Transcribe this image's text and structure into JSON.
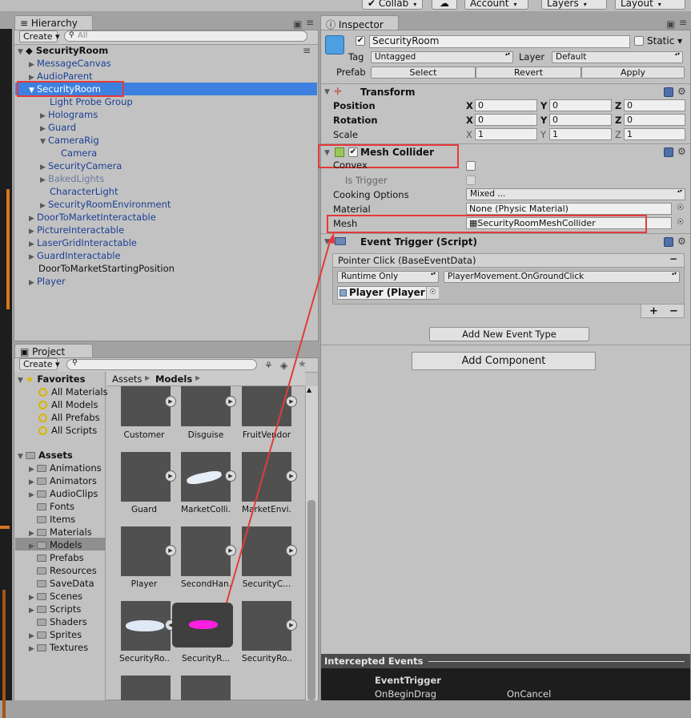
{
  "toolbar": {
    "collab": "Collab",
    "account": "Account",
    "layers": "Layers",
    "layout": "Layout"
  },
  "hierarchy": {
    "tab": "Hierarchy",
    "create": "Create",
    "search_placeholder": "All",
    "scene": "SecurityRoom",
    "items": [
      {
        "label": "MessageCanvas"
      },
      {
        "label": "AudioParent"
      },
      {
        "label": "SecurityRoom"
      },
      {
        "label": "Light Probe Group"
      },
      {
        "label": "Holograms"
      },
      {
        "label": "Guard"
      },
      {
        "label": "CameraRig"
      },
      {
        "label": "Camera"
      },
      {
        "label": "SecurityCamera"
      },
      {
        "label": "BakedLights"
      },
      {
        "label": "CharacterLight"
      },
      {
        "label": "SecurityRoomEnvironment"
      },
      {
        "label": "DoorToMarketInteractable"
      },
      {
        "label": "PictureInteractable"
      },
      {
        "label": "LaserGridInteractable"
      },
      {
        "label": "GuardInteractable"
      },
      {
        "label": "DoorToMarketStartingPosition"
      },
      {
        "label": "Player"
      }
    ]
  },
  "project": {
    "tab": "Project",
    "create": "Create",
    "favorites_label": "Favorites",
    "favorites": [
      "All Materials",
      "All Models",
      "All Prefabs",
      "All Scripts"
    ],
    "assets_label": "Assets",
    "folders": [
      "Animations",
      "Animators",
      "AudioClips",
      "Fonts",
      "Items",
      "Materials",
      "Models",
      "Prefabs",
      "Resources",
      "SaveData",
      "Scenes",
      "Scripts",
      "Shaders",
      "Sprites",
      "Textures"
    ],
    "breadcrumb": {
      "root": "Assets",
      "current": "Models"
    },
    "assets": [
      "Customer",
      "Disguise",
      "FruitVendor",
      "Guard",
      "MarketColli...",
      "MarketEnvi...",
      "Player",
      "SecondHan...",
      "SecurityC...",
      "SecurityRo...",
      "SecurityR...",
      "SecurityRo..."
    ]
  },
  "inspector": {
    "tab": "Inspector",
    "object_name": "SecurityRoom",
    "static_label": "Static",
    "tag_label": "Tag",
    "tag_value": "Untagged",
    "layer_label": "Layer",
    "layer_value": "Default",
    "prefab_label": "Prefab",
    "prefab_select": "Select",
    "prefab_revert": "Revert",
    "prefab_apply": "Apply",
    "transform": {
      "title": "Transform",
      "position_label": "Position",
      "rotation_label": "Rotation",
      "scale_label": "Scale",
      "x": "X",
      "y": "Y",
      "z": "Z",
      "position": [
        "0",
        "0",
        "0"
      ],
      "rotation": [
        "0",
        "0",
        "0"
      ],
      "scale": [
        "1",
        "1",
        "1"
      ]
    },
    "mesh_collider": {
      "title": "Mesh Collider",
      "convex_label": "Convex",
      "is_trigger_label": "Is Trigger",
      "cooking_label": "Cooking Options",
      "cooking_value": "Mixed ...",
      "material_label": "Material",
      "material_value": "None (Physic Material)",
      "mesh_label": "Mesh",
      "mesh_value": "SecurityRoomMeshCollider"
    },
    "event_trigger": {
      "title": "Event Trigger (Script)",
      "entry": "Pointer Click (BaseEventData)",
      "runtime": "Runtime Only",
      "function": "PlayerMovement.OnGroundClick",
      "object": "Player (Player",
      "plus": "+",
      "minus": "−",
      "remove": "−",
      "add_event": "Add New Event Type"
    },
    "add_component": "Add Component",
    "intercepted": {
      "title": "Intercepted Events",
      "heading": "EventTrigger",
      "events": [
        "OnBeginDrag",
        "OnCancel"
      ]
    }
  },
  "colors": {
    "selection": "#3d80df",
    "annotation_red": "#e43a3a"
  }
}
